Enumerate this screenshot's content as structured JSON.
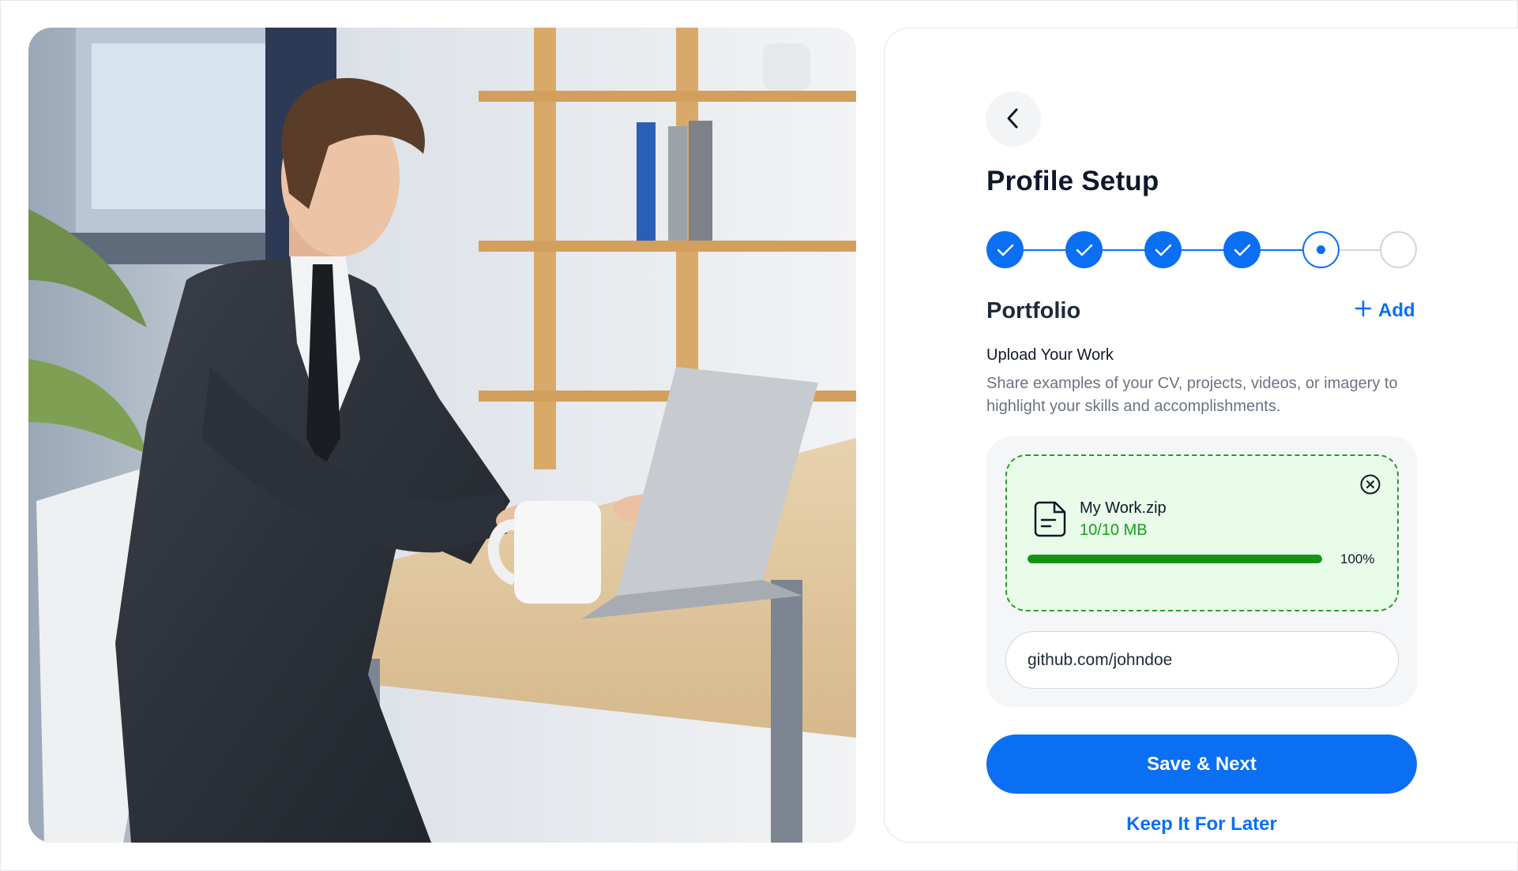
{
  "colors": {
    "accent": "#0a6ff2",
    "success": "#149414",
    "dropzone_bg": "#e9fbe9",
    "muted_text": "#6b7280"
  },
  "hero_image": {
    "icon": "photo-man-working-on-laptop"
  },
  "header": {
    "back_icon": "chevron-left-icon",
    "title": "Profile Setup"
  },
  "stepper": {
    "total_steps": 6,
    "completed_steps": 4,
    "current_step": 5
  },
  "portfolio": {
    "section_title": "Portfolio",
    "add_label": "Add",
    "add_icon": "plus-icon",
    "upload_label": "Upload Your Work",
    "upload_description": "Share examples of your CV, projects, videos, or imagery to highlight your skills and accomplishments."
  },
  "upload": {
    "file_icon": "document-icon",
    "file_name": "My Work.zip",
    "file_size": "10/10 MB",
    "progress": 100,
    "progress_label": "100%",
    "remove_icon": "close-circle-icon"
  },
  "link_input": {
    "value": "github.com/johndoe",
    "placeholder": ""
  },
  "actions": {
    "save_label": "Save & Next",
    "later_label": "Keep It For Later"
  }
}
